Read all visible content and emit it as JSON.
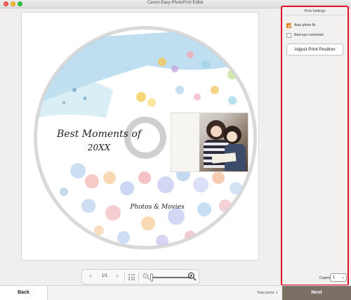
{
  "window": {
    "title": "Canon Easy-PhotoPrint Editor"
  },
  "disc": {
    "title": "Best Moments of",
    "year": "20XX",
    "subtitle": "Photos & Movies"
  },
  "page_nav": {
    "page_indicator": "1/1"
  },
  "zoom": {
    "level": 0
  },
  "print_settings": {
    "heading": "Print Settings",
    "auto_photo_fix_label": "Auto photo fix",
    "auto_photo_fix_checked": true,
    "red_eye_label": "Red-eye correction",
    "red_eye_checked": false,
    "adjust_button_label": "Adjust Print Position",
    "copies_label": "Copies",
    "copies_value": "1"
  },
  "footer": {
    "back_label": "Back",
    "total_prints": "Total prints: 1",
    "next_label": "Next"
  },
  "colors": {
    "highlight_border": "#e0122b",
    "checkbox_accent": "#f0892b",
    "next_button": "#7a7065"
  }
}
